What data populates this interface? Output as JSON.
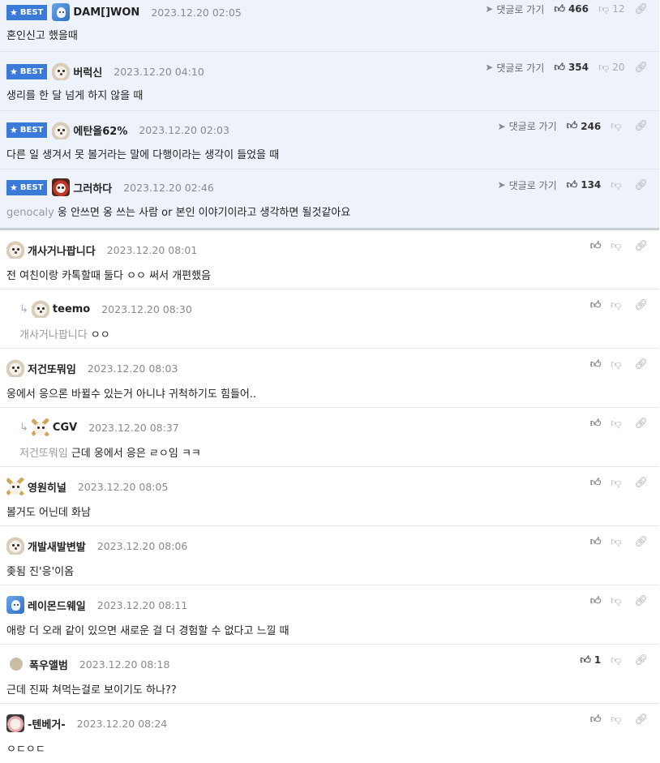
{
  "best_label": "BEST",
  "goto_label": "댓글로 가기",
  "comments": [
    {
      "best": true,
      "nick": "DAM[]WON",
      "date": "2023.12.20 02:05",
      "avatar": "blue-icon",
      "text": "혼인신고 했을때",
      "reply_to": "",
      "up": "466",
      "down": "12"
    },
    {
      "best": true,
      "nick": "버럭신",
      "date": "2023.12.20 04:10",
      "avatar": "dog-icon",
      "text": "생리를 한 달 넘게 하지 않을 때",
      "reply_to": "",
      "up": "354",
      "down": "20"
    },
    {
      "best": true,
      "nick": "에탄올62%",
      "date": "2023.12.20 02:03",
      "avatar": "dog-icon",
      "text": "다른 일 생겨서 못 볼거라는 말에 다행이라는 생각이 들었을 때",
      "reply_to": "",
      "up": "246",
      "down": ""
    },
    {
      "best": true,
      "nick": "그러하다",
      "date": "2023.12.20 02:46",
      "avatar": "lion-icon",
      "text": "웅 안쓰면 옹 쓰는 사람 or 본인 이야기이라고 생각하면 될것같아요",
      "reply_to": "genocaly",
      "up": "134",
      "down": ""
    },
    {
      "best": false,
      "reply": false,
      "nick": "개사거나팝니다",
      "date": "2023.12.20 08:01",
      "avatar": "dog-icon",
      "text": "전 여친이랑 카톡할때 둘다 ㅇㅇ 써서 개편했음",
      "reply_to": "",
      "up": "",
      "down": ""
    },
    {
      "best": false,
      "reply": true,
      "nick": "teemo",
      "date": "2023.12.20 08:30",
      "avatar": "dog-icon",
      "text": "ㅇㅇ",
      "reply_to": "개사거나팝니다",
      "up": "",
      "down": ""
    },
    {
      "best": false,
      "reply": false,
      "nick": "저건또뭐임",
      "date": "2023.12.20 08:03",
      "avatar": "dog-icon",
      "text": "웅에서 응으론 바뀔수 있는거 아니냐 귀척하기도 힘들어..",
      "reply_to": "",
      "up": "",
      "down": ""
    },
    {
      "best": false,
      "reply": true,
      "nick": "CGV",
      "date": "2023.12.20 08:37",
      "avatar": "cat-icon",
      "text": "근데 웅에서 응은 ㄹㅇ임 ㅋㅋ",
      "reply_to": "저건또뭐임",
      "up": "",
      "down": ""
    },
    {
      "best": false,
      "reply": false,
      "nick": "영원히널",
      "date": "2023.12.20 08:05",
      "avatar": "cat-icon",
      "text": "볼거도 어닌데 화남",
      "reply_to": "",
      "up": "",
      "down": ""
    },
    {
      "best": false,
      "reply": false,
      "nick": "개발새발변발",
      "date": "2023.12.20 08:06",
      "avatar": "dog-icon",
      "text": "좆됨 진'응'이옴",
      "reply_to": "",
      "up": "",
      "down": ""
    },
    {
      "best": false,
      "reply": false,
      "nick": "레이몬드웨일",
      "date": "2023.12.20 08:11",
      "avatar": "blue-icon",
      "text": "애랑 더 오래 같이 있으면 새로운 걸 더 경험할 수 없다고 느낄 때",
      "reply_to": "",
      "up": "",
      "down": ""
    },
    {
      "best": false,
      "reply": false,
      "nick": "폭우앨범",
      "date": "2023.12.20 08:18",
      "avatar": "dot-icon",
      "text": "근데 진짜 쳐먹는걸로 보이기도 하나??",
      "reply_to": "",
      "up": "1",
      "down": ""
    },
    {
      "best": false,
      "reply": false,
      "nick": "-텐베거-",
      "date": "2023.12.20 08:24",
      "avatar": "tiger-icon",
      "text": "ㅇㄷㅇㄷ",
      "reply_to": "",
      "up": "",
      "down": ""
    }
  ]
}
